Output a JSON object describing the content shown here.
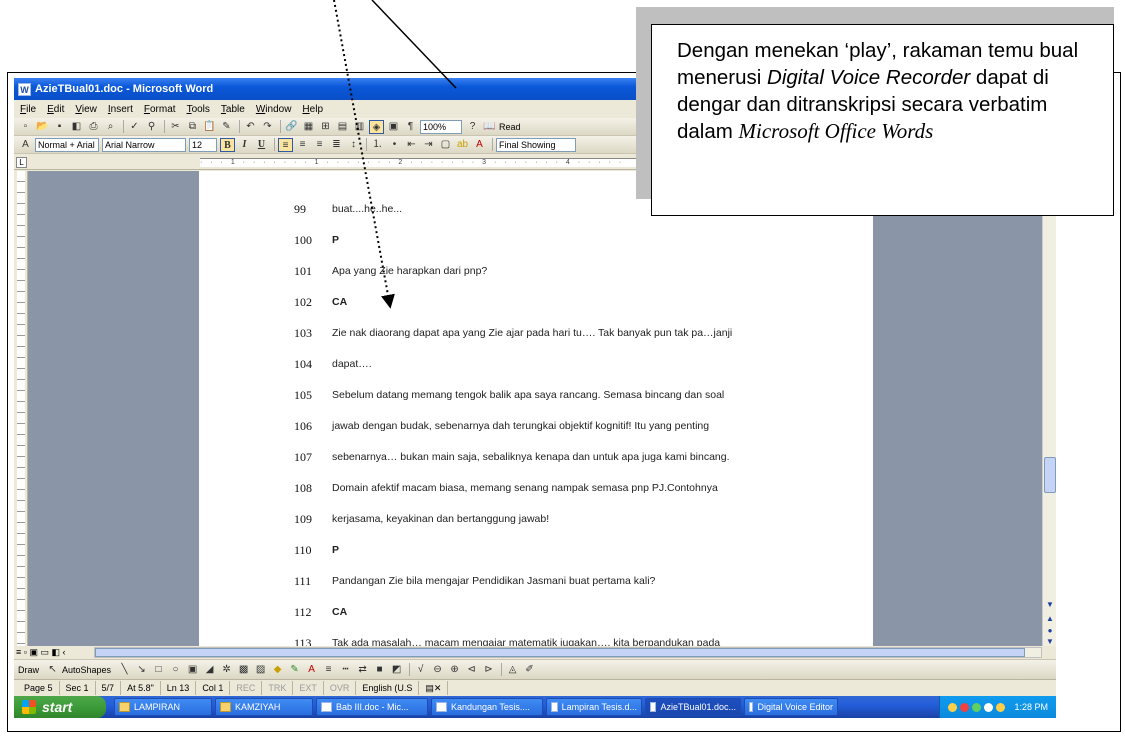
{
  "window": {
    "title": "AzieTBual01.doc - Microsoft Word"
  },
  "menu": [
    "File",
    "Edit",
    "View",
    "Insert",
    "Format",
    "Tools",
    "Table",
    "Window",
    "Help"
  ],
  "toolbar": {
    "zoom": "100%",
    "read_button": "Read",
    "style": "Normal + Arial I",
    "font": "Arial Narrow",
    "size": "12",
    "bold": "B",
    "italic": "I",
    "underline": "U",
    "final_showing": "Final Showing"
  },
  "document": {
    "lines": [
      {
        "num": "99",
        "text": "buat....he..he...",
        "bold": false
      },
      {
        "num": "100",
        "text": "P",
        "bold": true
      },
      {
        "num": "101",
        "text": "Apa yang Zie harapkan dari pnp?",
        "bold": false
      },
      {
        "num": "102",
        "text": "CA",
        "bold": true
      },
      {
        "num": "103",
        "text": "Zie nak diaorang dapat apa yang Zie ajar pada hari tu…. Tak banyak pun tak pa…janji",
        "bold": false
      },
      {
        "num": "104",
        "text": "dapat….",
        "bold": false
      },
      {
        "num": "105",
        "text": "Sebelum datang memang tengok balik apa saya rancang. Semasa bincang dan soal",
        "bold": false
      },
      {
        "num": "106",
        "text": "jawab dengan budak, sebenarnya dah terungkai objektif kognitif! Itu yang penting",
        "bold": false
      },
      {
        "num": "107",
        "text": "sebenarnya… bukan main saja, sebaliknya kenapa dan untuk apa juga  kami bincang.",
        "bold": false
      },
      {
        "num": "108",
        "text": "Domain afektif macam biasa, memang senang nampak semasa pnp PJ.Contohnya",
        "bold": false
      },
      {
        "num": "109",
        "text": "kerjasama, keyakinan dan bertanggung jawab!",
        "bold": false
      },
      {
        "num": "110",
        "text": "P",
        "bold": true
      },
      {
        "num": "111",
        "text": "Pandangan Zie bila mengajar Pendidikan Jasmani buat pertama kali?",
        "bold": false
      },
      {
        "num": "112",
        "text": "CA",
        "bold": true
      },
      {
        "num": "113",
        "text": "Tak ada masalah… macam mengajar matematik jugakan…. kita berpandukan pada",
        "bold": false
      }
    ]
  },
  "drawbar": {
    "draw": "Draw",
    "autoshapes": "AutoShapes"
  },
  "status": {
    "page": "Page 5",
    "sec": "Sec 1",
    "pages": "5/7",
    "at": "At 5.8\"",
    "ln": "Ln 13",
    "col": "Col 1",
    "rec": "REC",
    "trk": "TRK",
    "ext": "EXT",
    "ovr": "OVR",
    "lang": "English (U.S"
  },
  "taskbar": {
    "start": "start",
    "tasks": [
      {
        "label": "LAMPIRAN",
        "icon": "folder-icon",
        "active": false
      },
      {
        "label": "KAMZIYAH",
        "icon": "folder-icon",
        "active": false
      },
      {
        "label": "Bab III.doc - Mic...",
        "icon": "word-doc-icon",
        "active": false
      },
      {
        "label": "Kandungan Tesis....",
        "icon": "word-doc-icon",
        "active": false
      },
      {
        "label": "Lampiran Tesis.d...",
        "icon": "word-doc-icon",
        "active": false
      },
      {
        "label": "AzieTBual01.doc...",
        "icon": "word-doc-icon",
        "active": true
      },
      {
        "label": "Digital Voice Editor",
        "icon": "voice-editor-icon",
        "active": false
      }
    ],
    "clock": "1:28 PM"
  },
  "callout": {
    "part1": "Dengan menekan ‘play’,  rakaman temu bual menerusi ",
    "part2": "Digital Voice Recorder",
    "part3": " dapat  di dengar dan ditranskripsi secara verbatim dalam ",
    "part4": "Microsoft Office Words"
  }
}
